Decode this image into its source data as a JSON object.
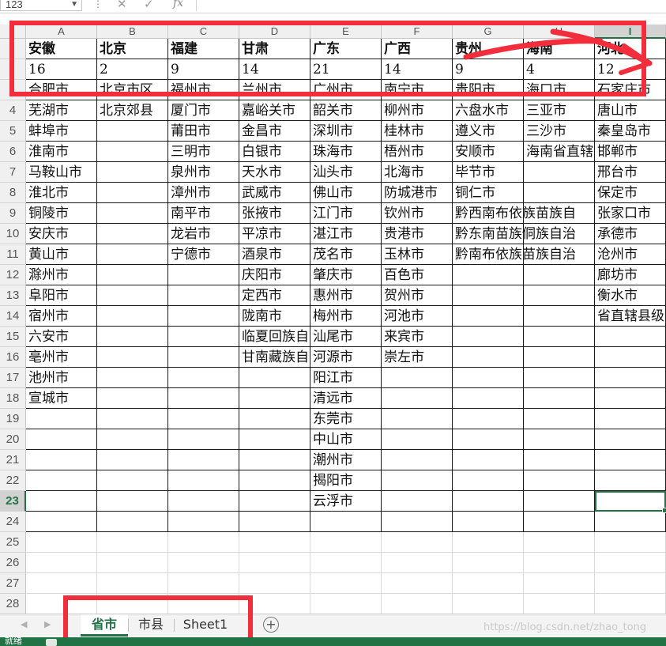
{
  "formula_bar": {
    "name_box": "123",
    "cancel_icon": "close-icon",
    "enter_icon": "check-icon",
    "function_label": "fx",
    "formula_value": ""
  },
  "columns": [
    "A",
    "B",
    "C",
    "D",
    "E",
    "F",
    "G",
    "H",
    "I"
  ],
  "active_column": "I",
  "rows": [
    {
      "n": "",
      "cells": [
        "安徽",
        "北京",
        "福建",
        "甘肃",
        "广东",
        "广西",
        "贵州",
        "海南",
        "河北"
      ]
    },
    {
      "n": "",
      "cells": [
        "16",
        "2",
        "9",
        "14",
        "21",
        "14",
        "9",
        "4",
        "12"
      ]
    },
    {
      "n": "",
      "cells": [
        "合肥市",
        "北京市区",
        "福州市",
        "兰州市",
        "广州市",
        "南宁市",
        "贵阳市",
        "海口市",
        "石家庄市"
      ]
    },
    {
      "n": "4",
      "cells": [
        "芜湖市",
        "北京郊县",
        "厦门市",
        "嘉峪关市",
        "韶关市",
        "柳州市",
        "六盘水市",
        "三亚市",
        "唐山市"
      ]
    },
    {
      "n": "5",
      "cells": [
        "蚌埠市",
        "",
        "莆田市",
        "金昌市",
        "深圳市",
        "桂林市",
        "遵义市",
        "三沙市",
        "秦皇岛市"
      ]
    },
    {
      "n": "6",
      "cells": [
        "淮南市",
        "",
        "三明市",
        "白银市",
        "珠海市",
        "梧州市",
        "安顺市",
        "海南省直辖",
        "邯郸市"
      ]
    },
    {
      "n": "7",
      "cells": [
        "马鞍山市",
        "",
        "泉州市",
        "天水市",
        "汕头市",
        "北海市",
        "毕节市",
        "",
        "邢台市"
      ]
    },
    {
      "n": "8",
      "cells": [
        "淮北市",
        "",
        "漳州市",
        "武威市",
        "佛山市",
        "防城港市",
        "铜仁市",
        "",
        "保定市"
      ]
    },
    {
      "n": "9",
      "cells": [
        "铜陵市",
        "",
        "南平市",
        "张掖市",
        "江门市",
        "钦州市",
        "黔西南布依族苗族自",
        "",
        "张家口市"
      ]
    },
    {
      "n": "10",
      "cells": [
        "安庆市",
        "",
        "龙岩市",
        "平凉市",
        "湛江市",
        "贵港市",
        "黔东南苗族侗族自治",
        "",
        "承德市"
      ]
    },
    {
      "n": "11",
      "cells": [
        "黄山市",
        "",
        "宁德市",
        "酒泉市",
        "茂名市",
        "玉林市",
        "黔南布依族苗族自治",
        "",
        "沧州市"
      ]
    },
    {
      "n": "12",
      "cells": [
        "滁州市",
        "",
        "",
        "庆阳市",
        "肇庆市",
        "百色市",
        "",
        "",
        "廊坊市"
      ]
    },
    {
      "n": "13",
      "cells": [
        "阜阳市",
        "",
        "",
        "定西市",
        "惠州市",
        "贺州市",
        "",
        "",
        "衡水市"
      ]
    },
    {
      "n": "14",
      "cells": [
        "宿州市",
        "",
        "",
        "陇南市",
        "梅州市",
        "河池市",
        "",
        "",
        "省直辖县级"
      ]
    },
    {
      "n": "15",
      "cells": [
        "六安市",
        "",
        "",
        "临夏回族自",
        "汕尾市",
        "来宾市",
        "",
        "",
        ""
      ]
    },
    {
      "n": "16",
      "cells": [
        "亳州市",
        "",
        "",
        "甘南藏族自",
        "河源市",
        "崇左市",
        "",
        "",
        ""
      ]
    },
    {
      "n": "17",
      "cells": [
        "池州市",
        "",
        "",
        "",
        "阳江市",
        "",
        "",
        "",
        ""
      ]
    },
    {
      "n": "18",
      "cells": [
        "宣城市",
        "",
        "",
        "",
        "清远市",
        "",
        "",
        "",
        ""
      ]
    },
    {
      "n": "19",
      "cells": [
        "",
        "",
        "",
        "",
        "东莞市",
        "",
        "",
        "",
        ""
      ]
    },
    {
      "n": "20",
      "cells": [
        "",
        "",
        "",
        "",
        "中山市",
        "",
        "",
        "",
        ""
      ]
    },
    {
      "n": "21",
      "cells": [
        "",
        "",
        "",
        "",
        "潮州市",
        "",
        "",
        "",
        ""
      ]
    },
    {
      "n": "22",
      "cells": [
        "",
        "",
        "",
        "",
        "揭阳市",
        "",
        "",
        "",
        ""
      ]
    },
    {
      "n": "23",
      "cells": [
        "",
        "",
        "",
        "",
        "云浮市",
        "",
        "",
        "",
        ""
      ]
    },
    {
      "n": "24",
      "cells": [
        "",
        "",
        "",
        "",
        "",
        "",
        "",
        "",
        ""
      ]
    },
    {
      "n": "25",
      "cells": [
        "",
        "",
        "",
        "",
        "",
        "",
        "",
        "",
        ""
      ]
    },
    {
      "n": "26",
      "cells": [
        "",
        "",
        "",
        "",
        "",
        "",
        "",
        "",
        ""
      ]
    },
    {
      "n": "27",
      "cells": [
        "",
        "",
        "",
        "",
        "",
        "",
        "",
        "",
        ""
      ]
    },
    {
      "n": "28",
      "cells": [
        "",
        "",
        "",
        "",
        "",
        "",
        "",
        "",
        ""
      ]
    }
  ],
  "active_row": "23",
  "sheet_tabs": [
    {
      "label": "省市",
      "active": true
    },
    {
      "label": "市县",
      "active": false
    },
    {
      "label": "Sheet1",
      "active": false
    }
  ],
  "status_text": "就绪",
  "watermark": "https://blog.csdn.net/zhao_tong",
  "colors": {
    "accent": "#217346",
    "annotation": "#f22d3c"
  },
  "icons": {
    "add_sheet": "plus-circle-icon",
    "prev_sheet": "triangle-left-icon",
    "next_sheet": "triangle-right-icon"
  }
}
